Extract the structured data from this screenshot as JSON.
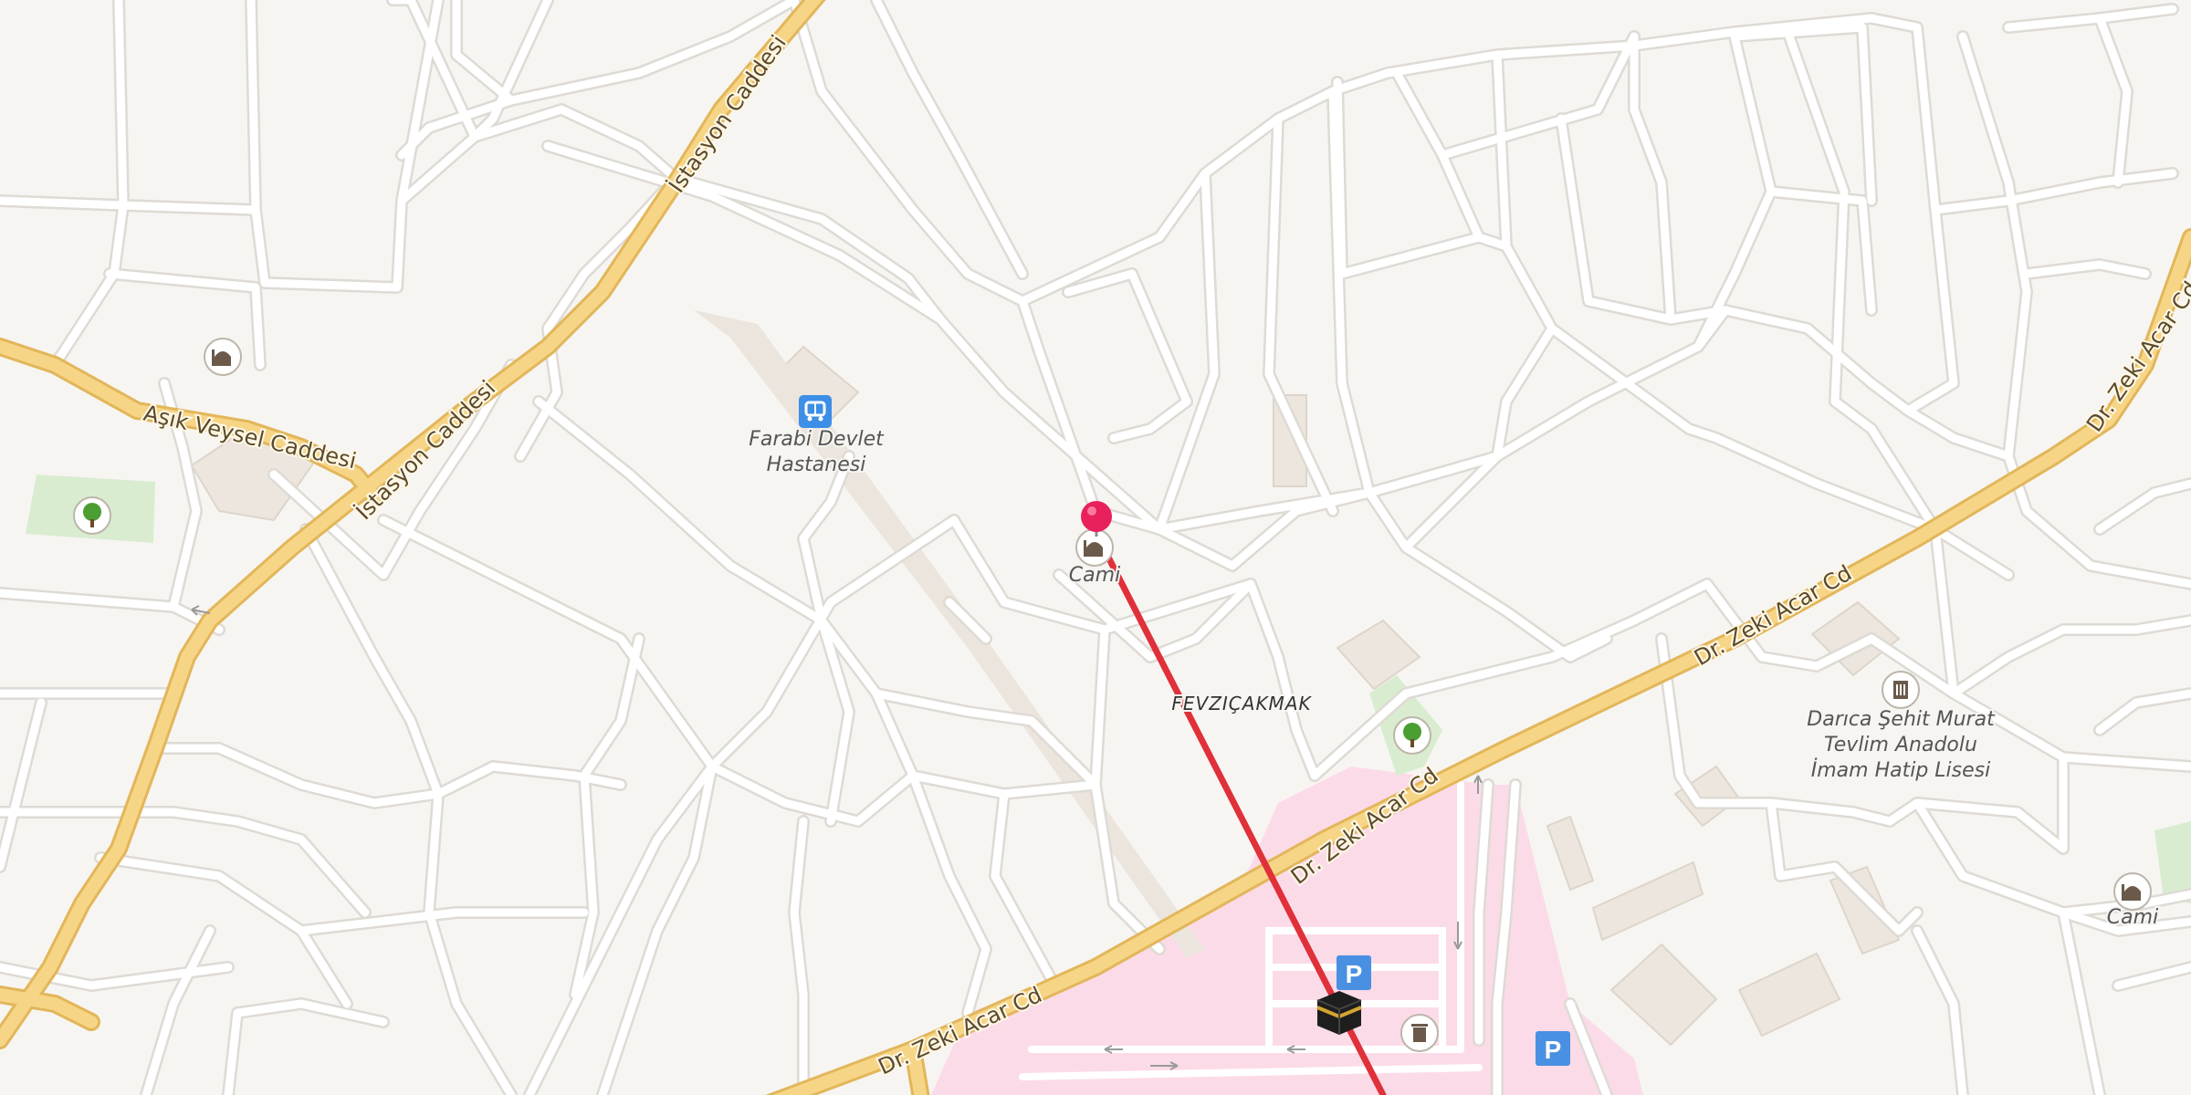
{
  "map": {
    "streets": {
      "istasyon_top": "İstasyon Caddesi",
      "istasyon_mid": "İstasyon Caddesi",
      "asik_veysel": "Aşık Veysel Caddesi",
      "zeki_acar_1": "Dr. Zeki Acar Cd",
      "zeki_acar_2": "Dr. Zeki Acar Cd",
      "zeki_acar_3": "Dr. Zeki Acar Cd",
      "zeki_acar_4": "Dr. Zeki Acar Cd"
    },
    "pois": {
      "hospital_line1": "Farabi Devlet",
      "hospital_line2": "Hastanesi",
      "mosque_center": "Cami",
      "mosque_right": "Cami",
      "school_line1": "Darıca Şehit Murat",
      "school_line2": "Tevlim Anadolu",
      "school_line3": "İmam Hatip Lisesi"
    },
    "district": "FEVZIÇAKMAK",
    "parking_symbol": "P",
    "colors": {
      "background": "#f7f5f2",
      "road_minor": "#ffffff",
      "road_casing": "#dedad4",
      "road_major": "#f7d586",
      "road_major_casing": "#e2b65a",
      "park": "#d9ecd0",
      "pink_area": "#fcdbe8",
      "building": "#ece6de",
      "route_line": "#e0303a",
      "pin": "#e8205c",
      "parking": "#4a90e2",
      "hospital": "#3c8ee6"
    },
    "icons": {
      "pin": "location-pin-icon",
      "mosque": "mosque-icon",
      "hospital": "hospital-icon",
      "park": "tree-icon",
      "school": "school-icon",
      "parking": "parking-icon",
      "kaaba": "kaaba-icon",
      "trash": "trash-icon"
    }
  }
}
